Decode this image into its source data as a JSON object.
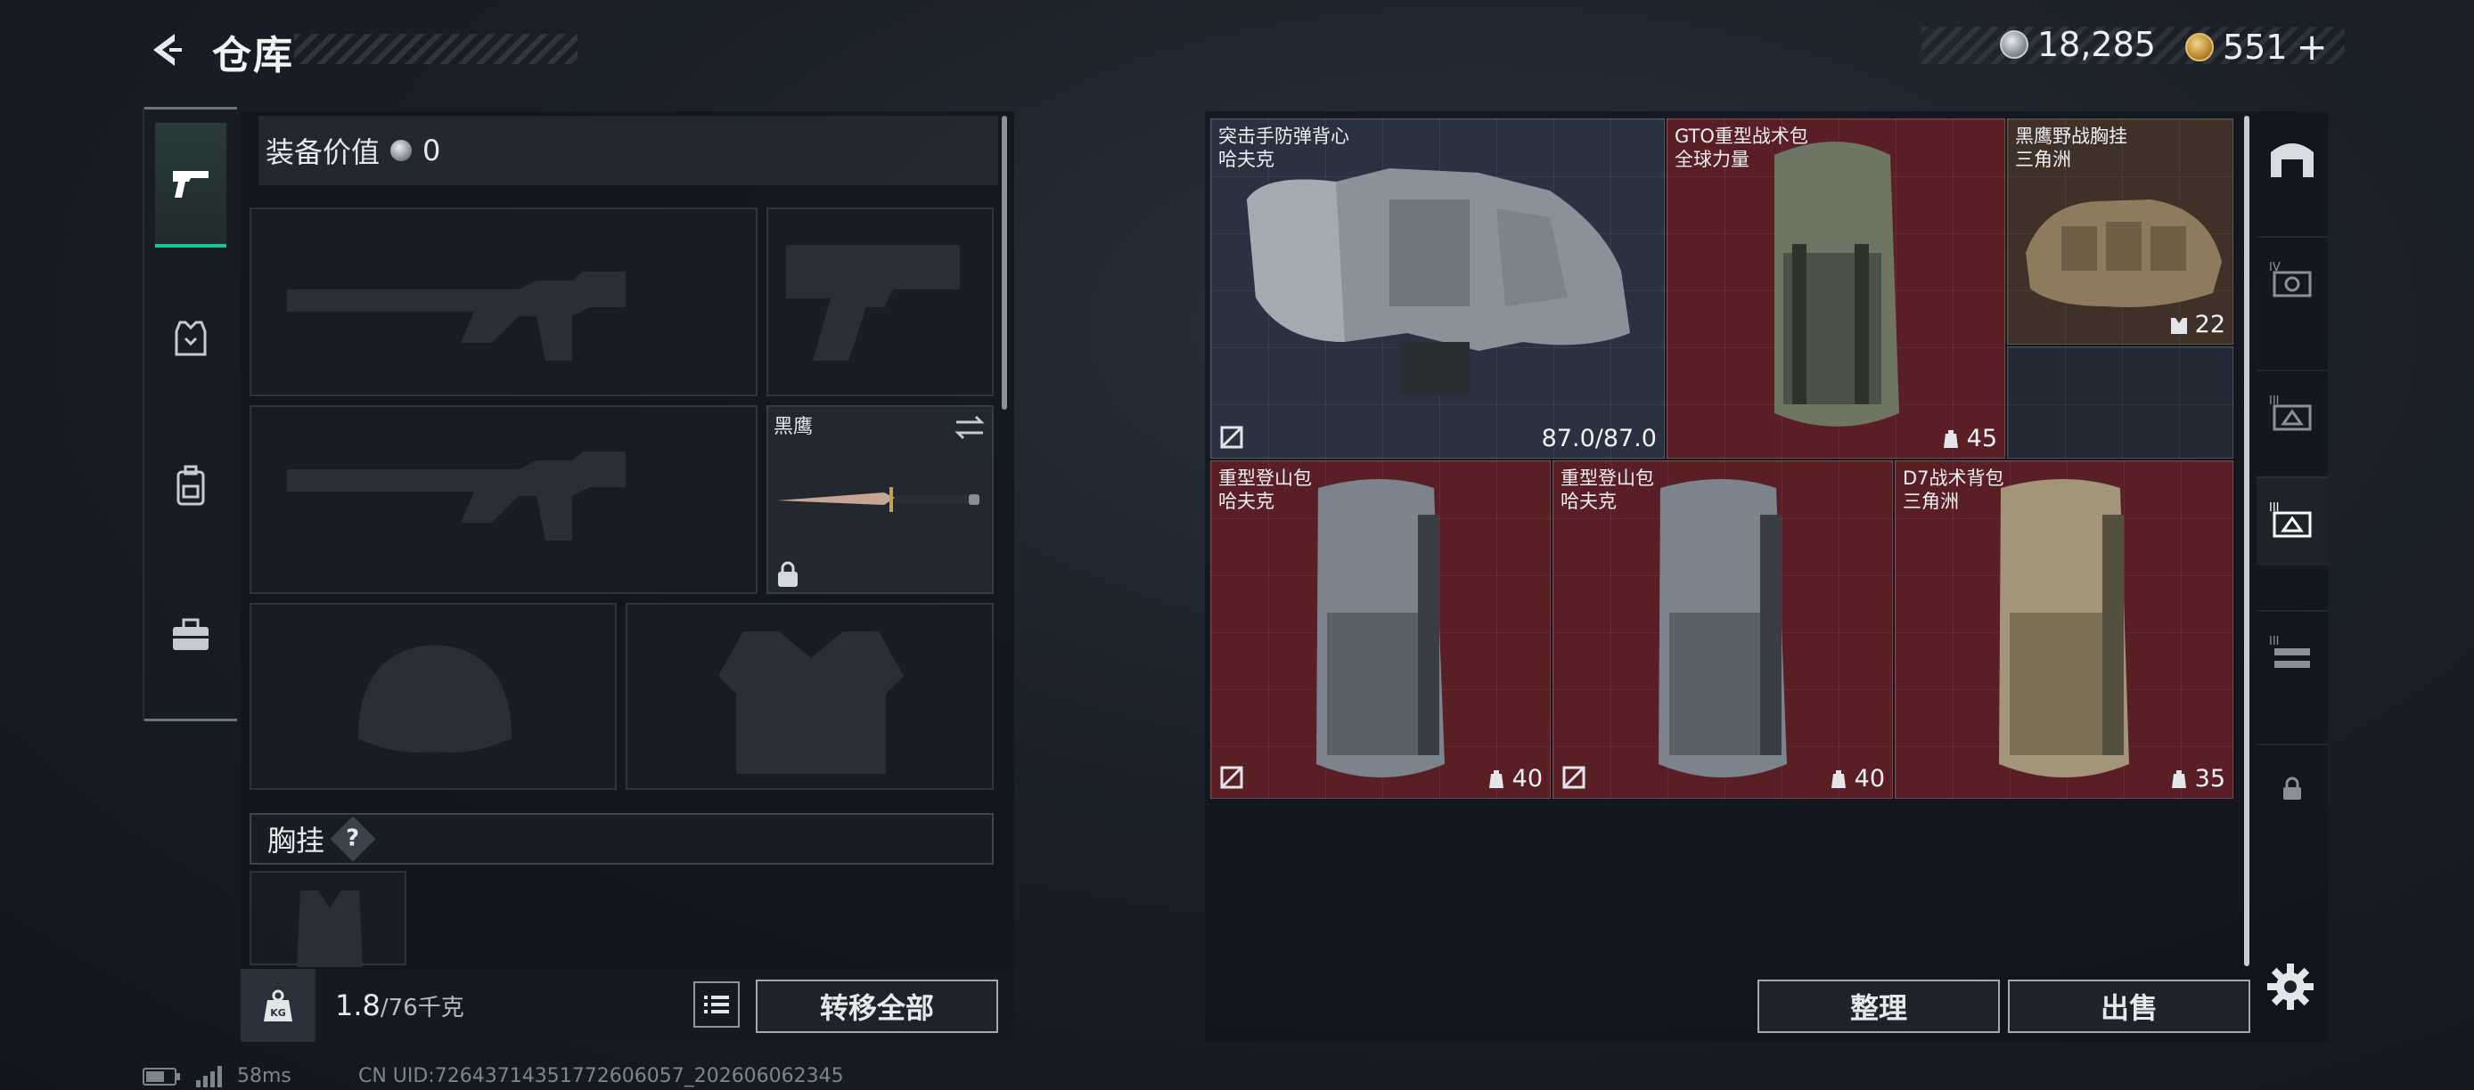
{
  "header": {
    "title": "仓库",
    "currency_silver": "18,285",
    "currency_gold": "551",
    "add_symbol": "+"
  },
  "loadout": {
    "value_label": "装备价值",
    "value": "0",
    "knife_name": "黑鹰",
    "chest_rig_label": "胸挂",
    "help_symbol": "?",
    "weight_current": "1.8",
    "weight_max": "/76千克",
    "transfer_all": "转移全部"
  },
  "storage": {
    "items": [
      {
        "name1": "突击手防弹背心",
        "name2": "哈夫克",
        "stat": "87.0/87.0",
        "stat_icon": "durability",
        "flag": "no-insure-icon",
        "bg": "blue"
      },
      {
        "name1": "GTO重型战术包",
        "name2": "全球力量",
        "stat": "45",
        "stat_icon": "capacity",
        "bg": "red"
      },
      {
        "name1": "黑鹰野战胸挂",
        "name2": "三角洲",
        "stat": "22",
        "stat_icon": "capacity",
        "bg": "brown"
      },
      {
        "name1": "重型登山包",
        "name2": "哈夫克",
        "stat": "40",
        "stat_icon": "capacity",
        "flag": "no-insure-icon",
        "bg": "red"
      },
      {
        "name1": "重型登山包",
        "name2": "哈夫克",
        "stat": "40",
        "stat_icon": "capacity",
        "flag": "no-insure-icon",
        "bg": "red"
      },
      {
        "name1": "D7战术背包",
        "name2": "三角洲",
        "stat": "35",
        "stat_icon": "capacity",
        "bg": "red"
      }
    ],
    "sort_button": "整理",
    "sell_button": "出售"
  },
  "right_tabs": [
    "IV",
    "III",
    "III",
    "III"
  ],
  "footer": {
    "ping": "58ms",
    "uid": "CN UID:72643714351772606057_202606062345"
  },
  "colors": {
    "accent_green": "#19c59a",
    "item_red": "#5a1f25",
    "item_blue": "#2a3140",
    "item_brown": "#3f3128"
  }
}
